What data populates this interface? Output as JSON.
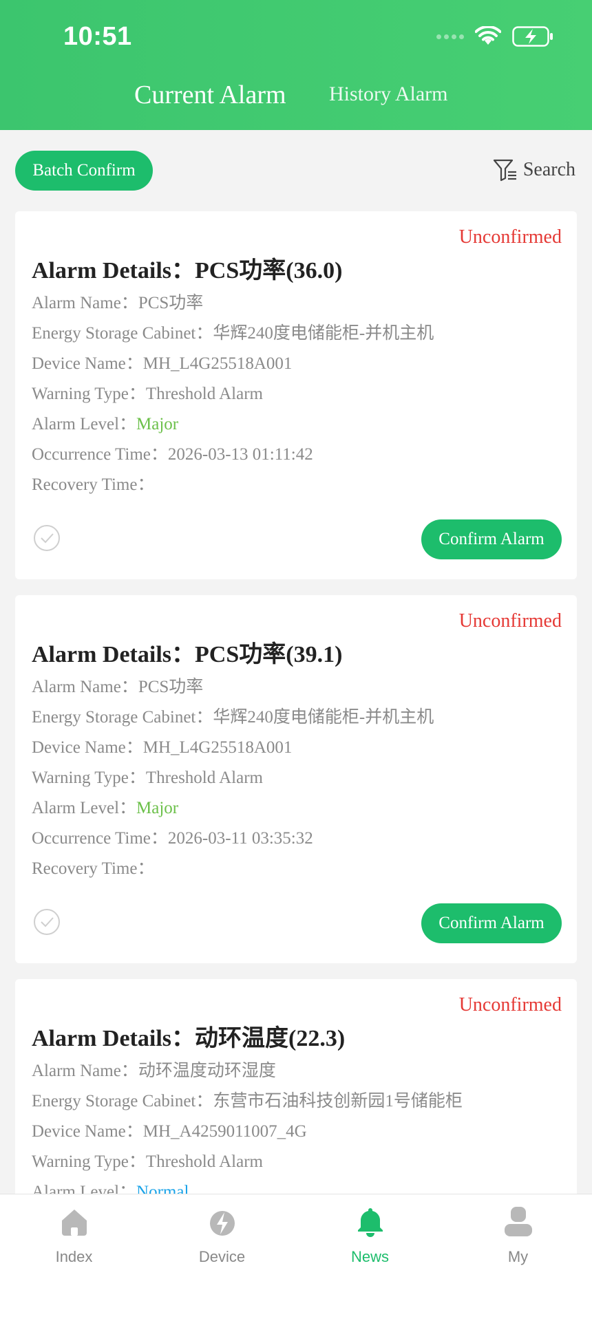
{
  "status_bar": {
    "time": "10:51"
  },
  "header": {
    "tabs": [
      {
        "label": "Current Alarm",
        "active": true
      },
      {
        "label": "History Alarm",
        "active": false
      }
    ]
  },
  "toolbar": {
    "batch_confirm_label": "Batch Confirm",
    "search_label": "Search"
  },
  "labels": {
    "alarm_details": "Alarm Details：",
    "alarm_name": "Alarm Name：",
    "cabinet": "Energy Storage Cabinet：",
    "device_name": "Device Name：",
    "warning_type": "Warning Type：",
    "alarm_level": "Alarm Level：",
    "occurrence_time": "Occurrence Time：",
    "recovery_time": "Recovery Time：",
    "confirm_alarm": "Confirm Alarm"
  },
  "alarms": [
    {
      "status": "Unconfirmed",
      "title": "PCS功率(36.0)",
      "alarm_name": "PCS功率",
      "cabinet": "华辉240度电储能柜-并机主机",
      "device_name": "MH_L4G25518A001",
      "warning_type": "Threshold Alarm",
      "alarm_level": "Major",
      "occurrence_time": "2026-03-13 01:11:42",
      "recovery_time": ""
    },
    {
      "status": "Unconfirmed",
      "title": "PCS功率(39.1)",
      "alarm_name": "PCS功率",
      "cabinet": "华辉240度电储能柜-并机主机",
      "device_name": "MH_L4G25518A001",
      "warning_type": "Threshold Alarm",
      "alarm_level": "Major",
      "occurrence_time": "2026-03-11 03:35:32",
      "recovery_time": ""
    },
    {
      "status": "Unconfirmed",
      "title": "动环温度(22.3)",
      "alarm_name": "动环温度动环湿度",
      "cabinet": "东营市石油科技创新园1号储能柜",
      "device_name": "MH_A4259011007_4G",
      "warning_type": "Threshold Alarm",
      "alarm_level": "Normal"
    }
  ],
  "bottom_nav": [
    {
      "label": "Index",
      "icon": "home-icon",
      "active": false
    },
    {
      "label": "Device",
      "icon": "lightning-icon",
      "active": false
    },
    {
      "label": "News",
      "icon": "bell-icon",
      "active": true
    },
    {
      "label": "My",
      "icon": "person-icon",
      "active": false
    }
  ],
  "colors": {
    "brand_green": "#1dbd6c",
    "header_green": "#3cc56e",
    "unconfirmed_red": "#e53935",
    "level_major": "#6cc04a",
    "level_normal": "#1aa3e8"
  }
}
